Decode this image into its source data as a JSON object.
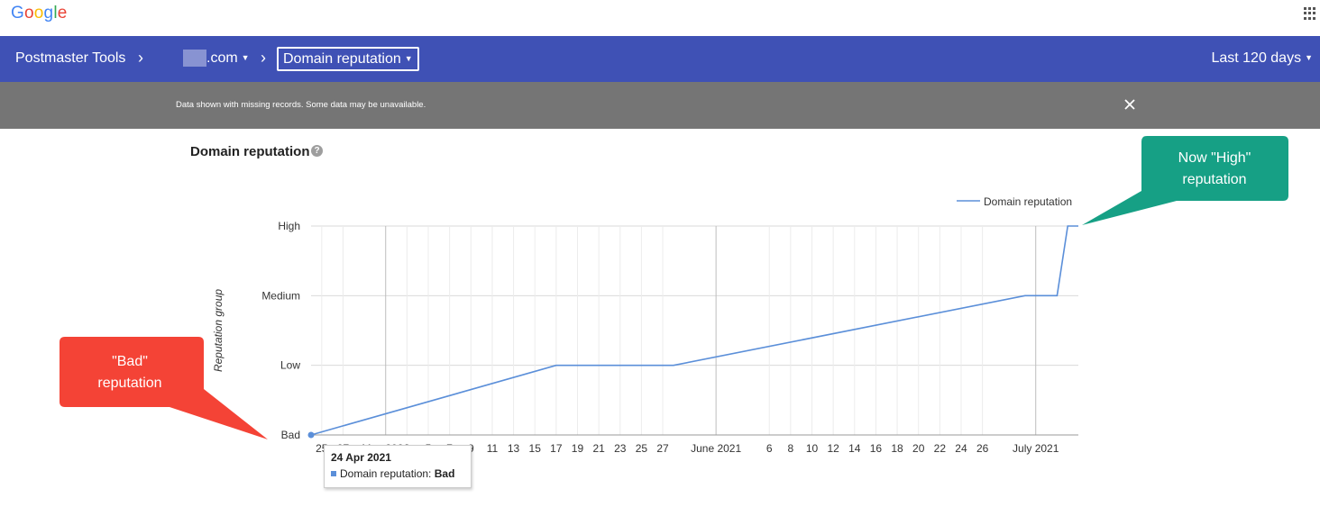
{
  "app": {
    "logo_text": "Google",
    "logo_letters": [
      {
        "ch": "G",
        "color": "#4285f4"
      },
      {
        "ch": "o",
        "color": "#ea4335"
      },
      {
        "ch": "o",
        "color": "#fbbc05"
      },
      {
        "ch": "g",
        "color": "#4285f4"
      },
      {
        "ch": "l",
        "color": "#34a853"
      },
      {
        "ch": "e",
        "color": "#ea4335"
      }
    ],
    "apps_icon": "apps-grid-icon"
  },
  "nav": {
    "title": "Postmaster Tools",
    "domain": ".com",
    "dashboard": "Domain reputation",
    "date_range": "Last 120 days",
    "accent": "#3f51b5"
  },
  "notice": {
    "message": "Data shown with missing records. Some data may be unavailable.",
    "close_icon": "close-icon"
  },
  "section": {
    "title": "Domain reputation",
    "help_icon": "help-icon"
  },
  "chart_data": {
    "type": "line",
    "ylabel": "Reputation group",
    "y_categories": [
      "Bad",
      "Low",
      "Medium",
      "High"
    ],
    "x_tick_labels": [
      "25",
      "27",
      "May 2021",
      "3",
      "5",
      "7",
      "9",
      "11",
      "13",
      "15",
      "17",
      "19",
      "21",
      "23",
      "25",
      "27",
      "June 2021",
      "6",
      "8",
      "10",
      "12",
      "14",
      "16",
      "18",
      "20",
      "22",
      "24",
      "26",
      "July 2021"
    ],
    "legend": "top-right",
    "grid": true,
    "series": [
      {
        "name": "Domain reputation",
        "color": "#5b8fd9",
        "points": [
          {
            "x": "2021-04-24",
            "y": "Bad"
          },
          {
            "x": "2021-05-17",
            "y": "Low"
          },
          {
            "x": "2021-05-28",
            "y": "Low"
          },
          {
            "x": "2021-06-30",
            "y": "Medium"
          },
          {
            "x": "2021-07-03",
            "y": "Medium"
          },
          {
            "x": "2021-07-04",
            "y": "High"
          },
          {
            "x": "2021-07-05",
            "y": "High"
          }
        ]
      }
    ]
  },
  "tooltip": {
    "date": "24 Apr 2021",
    "series_label": "Domain reputation:",
    "value": "Bad"
  },
  "annotations": {
    "bad": {
      "line1": "\"Bad\"",
      "line2": "reputation",
      "color": "#f44336"
    },
    "high": {
      "line1": "Now \"High\"",
      "line2": "reputation",
      "color": "#16a085"
    }
  }
}
